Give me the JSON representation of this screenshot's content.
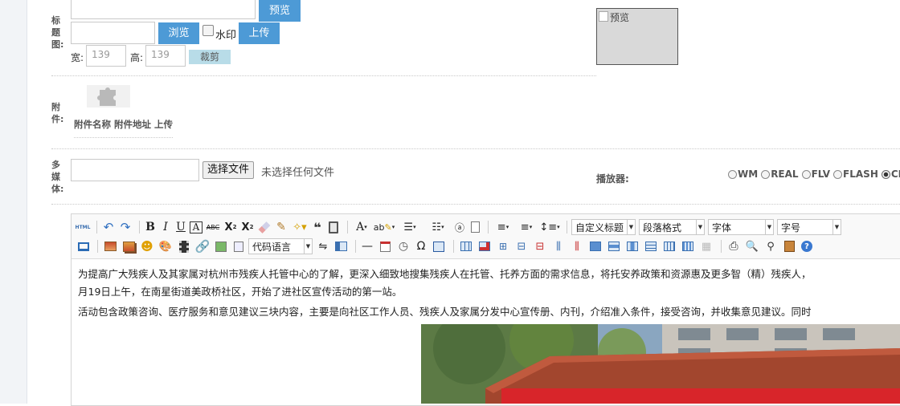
{
  "title_image": {
    "label": "标题图:",
    "preview_btn": "预览",
    "browse_btn": "浏览",
    "watermark_label": "水印",
    "upload_btn": "上传",
    "width_label": "宽:",
    "width_value": "139",
    "height_label": "高:",
    "height_value": "139",
    "crop_btn": "裁剪",
    "preview_alt": "预览"
  },
  "attachment": {
    "label": "附件:",
    "header_text": "附件名称 附件地址 上传"
  },
  "multimedia": {
    "label": "多媒体:",
    "choose_file_btn": "选择文件",
    "no_file_text": "未选择任何文件",
    "player_label": "播放器:",
    "player_options": [
      "WM",
      "REAL",
      "FLV",
      "FLASH",
      "CK"
    ],
    "player_selected": "CK"
  },
  "editor": {
    "toolbar_html": "HTML",
    "code_lang_select": "代码语言",
    "heading_select": "自定义标题",
    "paragraph_select": "段落格式",
    "font_select": "字体",
    "size_select": "字号",
    "content": {
      "p1_line1": "为提高广大残疾人及其家属对杭州市残疾人托管中心的了解，更深入细致地搜集残疾人在托管、托养方面的需求信息，将托安养政策和资源惠及更多智（精）残疾人，",
      "p1_line2": "月19日上午，在南星街道美政桥社区，开始了进社区宣传活动的第一站。",
      "p2_line1": "活动包含政策咨询、医疗服务和意见建议三块内容，主要是向社区工作人员、残疾人及家属分发中心宣传册、内刊，介绍准入条件，接受咨询，并收集意见建议。同时"
    }
  }
}
